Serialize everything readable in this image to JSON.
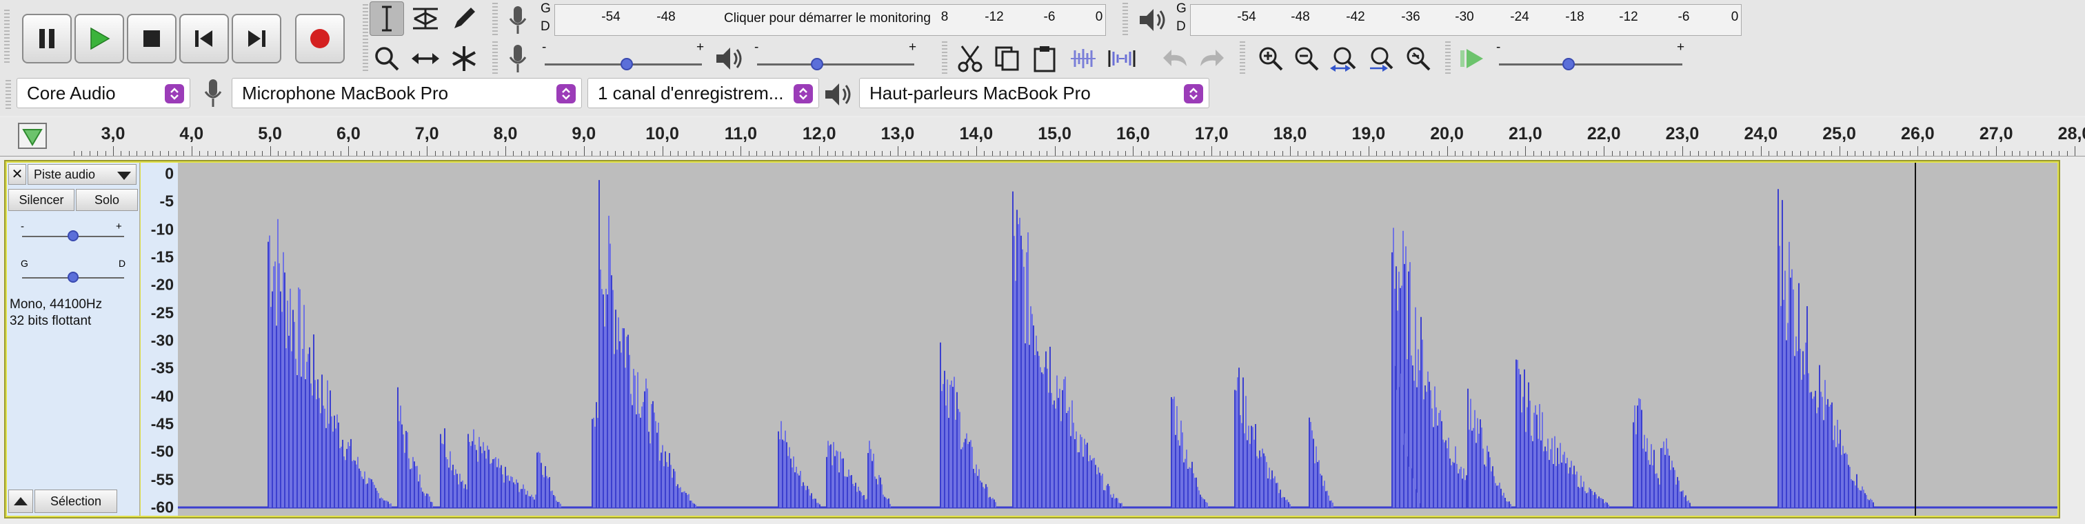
{
  "colors": {
    "waveform": "#3b3fcf",
    "waveform_fill": "#6f72e3",
    "track_selected_border": "#e2e24a",
    "record": "#d42121",
    "play": "#3bb33b",
    "combo_arrow": "#9b3cb8"
  },
  "transport": {
    "pause_icon": "pause-icon",
    "play_icon": "play-icon",
    "stop_icon": "stop-icon",
    "skip_start_icon": "skip-to-start-icon",
    "skip_end_icon": "skip-to-end-icon",
    "record_icon": "record-icon"
  },
  "record_meter": {
    "channel_top": "G",
    "channel_bottom": "D",
    "ticks": [
      "-54",
      "-48",
      "8",
      "-12",
      "-6",
      "0"
    ],
    "monitor_text": "Cliquer pour démarrer le monitoring"
  },
  "playback_meter": {
    "channel_top": "G",
    "channel_bottom": "D",
    "ticks": [
      "-54",
      "-48",
      "-42",
      "-36",
      "-30",
      "-24",
      "-18",
      "-12",
      "-6",
      "0"
    ]
  },
  "mixer": {
    "minus": "-",
    "plus": "+",
    "record_volume": 0.52,
    "playback_volume": 0.38
  },
  "playback_speed": {
    "minus": "-",
    "plus": "+",
    "value": 0.38
  },
  "devices": {
    "host": "Core Audio",
    "recording_device": "Microphone MacBook Pro",
    "channels": "1 canal d'enregistrem...",
    "playback_device": "Haut-parleurs MacBook Pro"
  },
  "ruler": {
    "labels": [
      "3,0",
      "4,0",
      "5,0",
      "6,0",
      "7,0",
      "8,0",
      "9,0",
      "10,0",
      "11,0",
      "12,0",
      "13,0",
      "14,0",
      "15,0",
      "16,0",
      "17,0",
      "18,0",
      "19,0",
      "20,0",
      "21,0",
      "22,0",
      "23,0",
      "24,0",
      "25,0",
      "26,0",
      "27,0",
      "28,0"
    ]
  },
  "track": {
    "name": "Piste audio",
    "mute_label": "Silencer",
    "solo_label": "Solo",
    "gain_minus": "-",
    "gain_plus": "+",
    "pan_left": "G",
    "pan_right": "D",
    "info_line1": "Mono, 44100Hz",
    "info_line2": "32 bits flottant",
    "select_label": "Sélection",
    "gain": 0.5,
    "pan": 0.5,
    "db_scale": [
      "0",
      "-5",
      "-10",
      "-15",
      "-20",
      "-25",
      "-30",
      "-35",
      "-40",
      "-45",
      "-50",
      "-55",
      "-60"
    ]
  }
}
